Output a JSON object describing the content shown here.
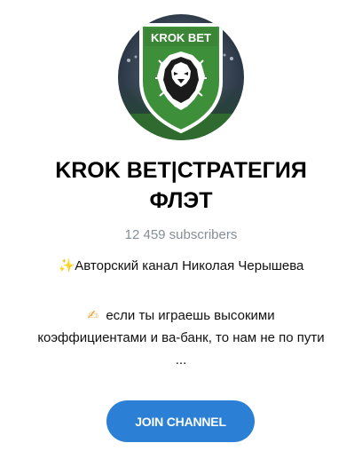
{
  "channel": {
    "avatar_text": "KROK BET",
    "title_line1": "KROK BET|СТРАТЕГИЯ",
    "title_line2": "ФЛЭТ",
    "subscribers": "12 459 subscribers",
    "description_emoji": "sparkles-emoji",
    "description": "Авторский канал Николая Черышева",
    "teaser_emoji": "writing-hand-emoji",
    "teaser_line1": "если ты играешь высокими",
    "teaser_line2": "коэффициентами и ва-банк, то нам не по пути",
    "teaser_line3": "..."
  },
  "actions": {
    "join_label": "JOIN CHANNEL"
  },
  "colors": {
    "accent": "#2b7fd4",
    "subscribers_text": "#868e96",
    "logo_green": "#3e8f3a"
  }
}
